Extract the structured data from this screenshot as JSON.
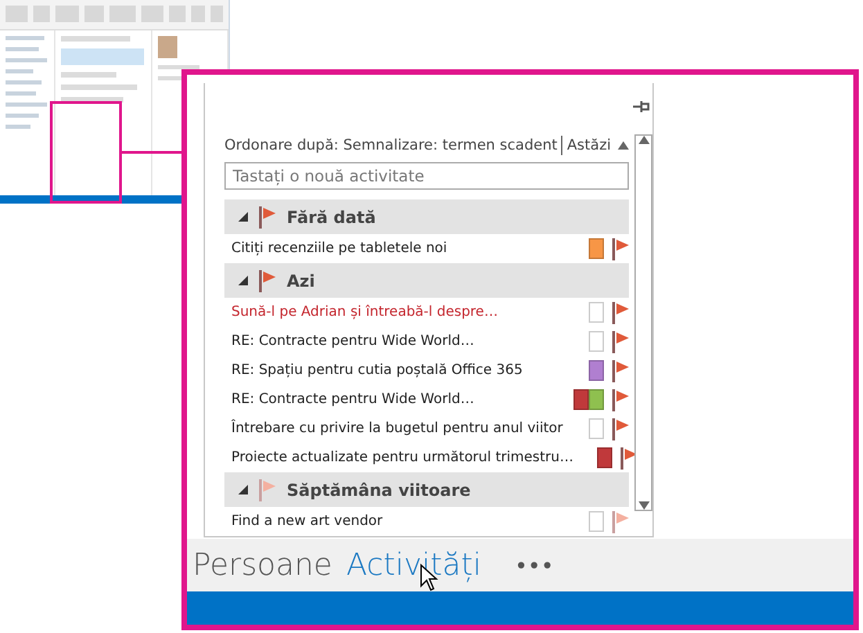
{
  "tasks_pane": {
    "sort_label": "Ordonare după: Semnalizare: termen scadent",
    "sort_filter": "Astăzi",
    "new_task": {
      "placeholder": "Tastați o nouă activitate"
    },
    "groups": [
      {
        "label": "Fără dată",
        "kind": "current",
        "expanded": true,
        "tasks": [
          {
            "title": "Citiți recenziile pe tabletele noi",
            "overdue": false,
            "categories": [
              {
                "color": "#f79646"
              }
            ]
          }
        ]
      },
      {
        "label": "Azi",
        "kind": "current",
        "expanded": true,
        "tasks": [
          {
            "title": "Sună-l pe Adrian și întreabă-l despre…",
            "overdue": true
          },
          {
            "title": "RE: Contracte pentru Wide World…",
            "overdue": false
          },
          {
            "title": "RE: Spațiu pentru cutia poștală Office 365",
            "overdue": false,
            "categories": [
              {
                "color": "#b07fd0"
              }
            ]
          },
          {
            "title": "RE: Contracte pentru Wide World…",
            "overdue": false,
            "categories": [
              {
                "color": "#c0393b"
              },
              {
                "color": "#8fc04f"
              }
            ]
          },
          {
            "title": "Întrebare cu privire la bugetul pentru anul viitor",
            "overdue": false
          },
          {
            "title": "Proiecte actualizate pentru următorul trimestru…",
            "overdue": false,
            "categories": [
              {
                "color": "#c0393b"
              }
            ]
          }
        ]
      },
      {
        "label": "Săptămâna viitoare",
        "kind": "future",
        "expanded": true,
        "tasks": [
          {
            "title": "Find a new art vendor",
            "overdue": false
          }
        ]
      }
    ]
  },
  "nav_bar": {
    "items": [
      {
        "label": "Persoane",
        "selected": false
      },
      {
        "label": "Activități",
        "selected": true
      }
    ],
    "more": "•••"
  }
}
